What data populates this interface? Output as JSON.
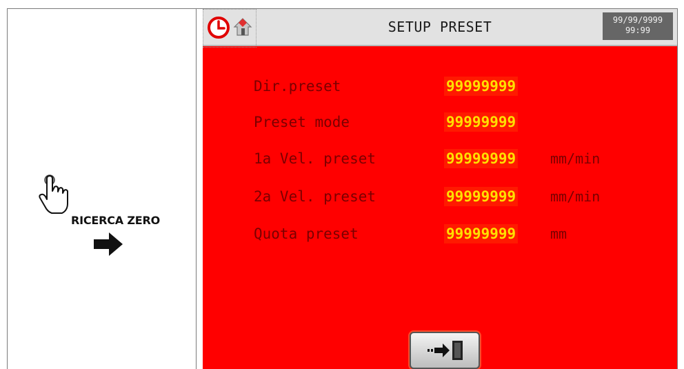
{
  "instruction": {
    "label": "RICERCA ZERO",
    "hand_icon": "pointing-hand-icon",
    "arrow_icon": "right-arrow-icon"
  },
  "screen": {
    "title": "SETUP PRESET",
    "date": "99/99/9999",
    "time": "99:99",
    "background_color": "#ff0000",
    "value_color": "#ffe000",
    "label_color": "#7a0000",
    "icons": [
      "clock-icon",
      "home-icon",
      "exit-door-icon"
    ]
  },
  "params": [
    {
      "label": "Dir.preset",
      "value": "99999999",
      "unit": ""
    },
    {
      "label": "Preset mode",
      "value": "99999999",
      "unit": ""
    },
    {
      "label": "1a Vel. preset",
      "value": "99999999",
      "unit": "mm/min"
    },
    {
      "label": "2a Vel. preset",
      "value": "99999999",
      "unit": "mm/min"
    },
    {
      "label": "Quota preset",
      "value": "99999999",
      "unit": "mm"
    }
  ]
}
